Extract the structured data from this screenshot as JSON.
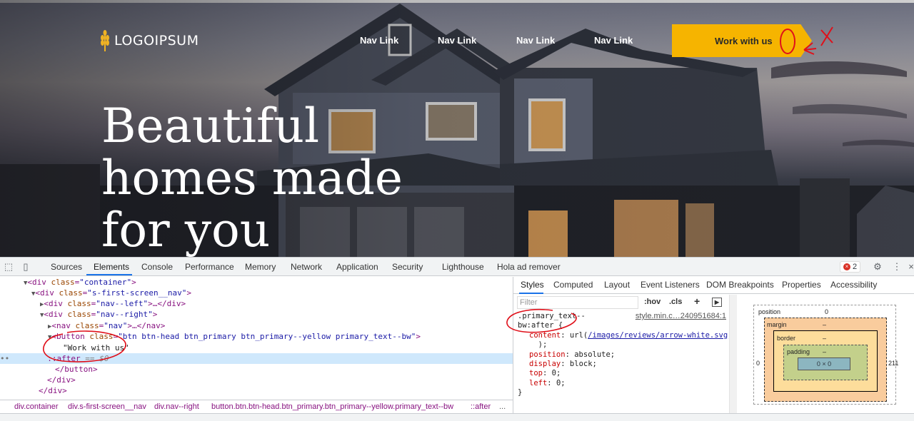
{
  "hero": {
    "logo_text": "LOGOIPSUM",
    "nav_links": [
      "Nav Link",
      "Nav Link",
      "Nav Link",
      "Nav Link"
    ],
    "cta_label": "Work with us",
    "headline": "Beautiful\nhomes made\nfor you",
    "accent_color": "#f6b400"
  },
  "devtools": {
    "tabs": [
      "Sources",
      "Elements",
      "Console",
      "Performance",
      "Memory",
      "Network",
      "Application",
      "Security",
      "Lighthouse",
      "Hola ad remover"
    ],
    "active_tab": "Elements",
    "error_count": "2",
    "dom_lines": [
      {
        "tag_open": "<div ",
        "attr": "class",
        "val": "\"container\"",
        "close": ">"
      },
      {
        "tag_open": "<div ",
        "attr": "class",
        "val": "\"s-first-screen__nav\"",
        "close": ">"
      },
      {
        "tag_open": "<div ",
        "attr": "class",
        "val": "\"nav--left\"",
        "close": ">…</div>"
      },
      {
        "tag_open": "<div ",
        "attr": "class",
        "val": "\"nav--right\"",
        "close": ">"
      },
      {
        "tag_open": "<nav ",
        "attr": "class",
        "val": "\"nav\"",
        "close": ">…</nav>"
      },
      {
        "tag_open": "<button ",
        "attr": "class",
        "val": "\"btn btn-head btn_primary btn_primary--yellow primary_text--bw\"",
        "close": ">"
      },
      {
        "text": "\"Work with us\""
      },
      {
        "pseudo": "::after",
        "eq": " == $0"
      },
      {
        "tag_close": "</button>"
      },
      {
        "tag_close": "</div>"
      },
      {
        "tag_close": "</div>"
      }
    ],
    "breadcrumbs": [
      "div.container",
      "div.s-first-screen__nav",
      "div.nav--right",
      "button.btn.btn-head.btn_primary.btn_primary--yellow.primary_text--bw",
      "::after",
      "..."
    ],
    "styles_tabs": [
      "Styles",
      "Computed",
      "Layout",
      "Event Listeners",
      "DOM Breakpoints",
      "Properties",
      "Accessibility"
    ],
    "filter_placeholder": "Filter",
    "filter_tools": [
      ":hov",
      ".cls",
      "+"
    ],
    "rule": {
      "selector_1": ".primary_text--",
      "selector_2": "bw:after {",
      "source": "style.min.c…240951684:1",
      "decls": [
        {
          "prop": "content",
          "value_pre": "url(",
          "url": "/images/reviews/arrow-white.svg",
          "value_post": ""
        },
        {
          "prop": "",
          "value_pre": "  );",
          "url": "",
          "value_post": ""
        },
        {
          "prop": "position",
          "value_pre": "absolute;",
          "url": "",
          "value_post": ""
        },
        {
          "prop": "display",
          "value_pre": "block;",
          "url": "",
          "value_post": ""
        },
        {
          "prop": "top",
          "value_pre": "0;",
          "url": "",
          "value_post": ""
        },
        {
          "prop": "left",
          "value_pre": "0;",
          "url": "",
          "value_post": ""
        }
      ],
      "close": "}"
    },
    "box_model": {
      "position_label": "position",
      "position_val": "0",
      "margin_label": "margin",
      "margin_val": "–",
      "border_label": "border",
      "border_val": "–",
      "padding_label": "padding",
      "padding_val": "–",
      "content_size": "0 × 0",
      "left_val": "0",
      "right_val": "211"
    }
  }
}
